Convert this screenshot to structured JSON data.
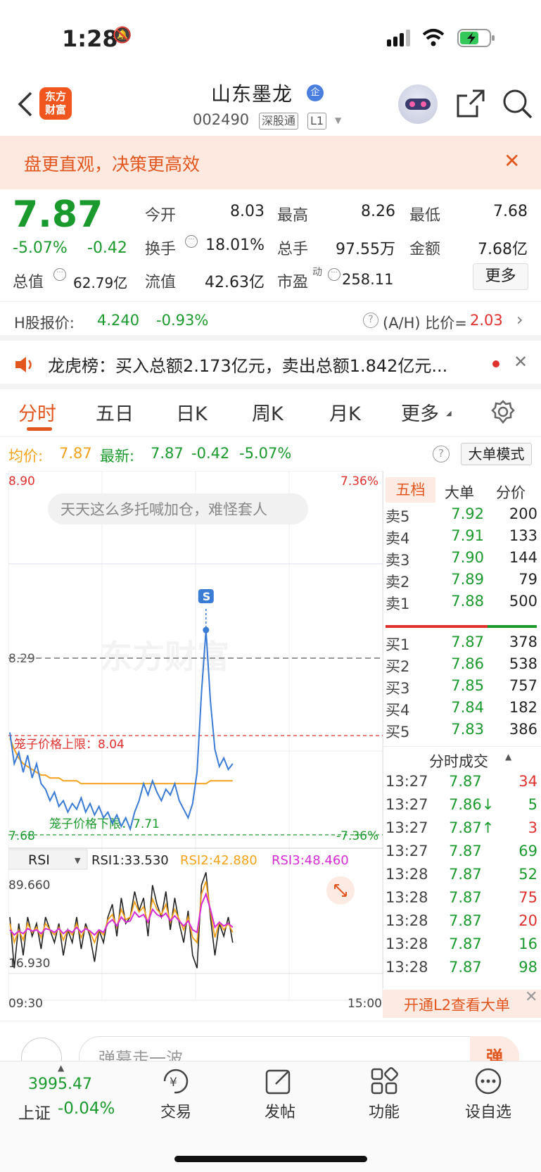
{
  "status": {
    "time": "1:28"
  },
  "header": {
    "logo_line1": "东方",
    "logo_line2": "财富",
    "stock_name": "山东墨龙",
    "qi_badge": "企",
    "stock_code": "002490",
    "tag_market": "深股通",
    "tag_level": "L1"
  },
  "banner": {
    "text": "盘更直观，决策更高效"
  },
  "quote": {
    "price": "7.87",
    "pct": "-5.07%",
    "change": "-0.42",
    "open_label": "今开",
    "open": "8.03",
    "high_label": "最高",
    "high": "8.26",
    "low_label": "最低",
    "low": "7.68",
    "turnover_label": "换手",
    "turnover": "18.01%",
    "volume_label": "总手",
    "volume": "97.55万",
    "amount_label": "金额",
    "amount": "7.68亿",
    "mktcap_label": "总值",
    "mktcap": "62.79亿",
    "float_label": "流值",
    "float": "42.63亿",
    "pe_label": "市盈",
    "pe_sup": "动",
    "pe": "258.11",
    "more": "更多"
  },
  "h_share": {
    "label": "H股报价:",
    "price": "4.240",
    "pct": "-0.93%",
    "ratio_label": "(A/H) 比价=",
    "ratio": "2.03"
  },
  "dragon_tiger": {
    "text": "龙虎榜：买入总额2.173亿元，卖出总额1.842亿元..."
  },
  "tabs": [
    "分时",
    "五日",
    "日K",
    "周K",
    "月K",
    "更多"
  ],
  "info": {
    "avg_label": "均价:",
    "avg": "7.87",
    "latest_label": "最新:",
    "latest": "7.87",
    "change": "-0.42",
    "pct": "-5.07%",
    "mode": "大单模式"
  },
  "chart": {
    "y_top": "8.90",
    "y_top_pct": "7.36%",
    "y_bottom": "7.68",
    "y_bottom_pct": "-7.36%",
    "prev_close": "8.29",
    "upper_limit_label": "笼子价格上限：8.04",
    "lower_limit_label": "笼子价格下限：7.71",
    "comment": "天天这么多托喊加仓，难怪套人",
    "watermark": "东方财富",
    "signal": "S",
    "time_start": "09:30",
    "time_end": "15:00",
    "rsi_select": "RSI",
    "rsi1": "RSI1:33.530",
    "rsi2": "RSI2:42.880",
    "rsi3": "RSI3:48.460",
    "rsi_top": "89.660",
    "rsi_bottom": "16.930",
    "colors": {
      "price": "#3a7bd5",
      "avg": "#f4a21a",
      "rsi1": "#222222",
      "rsi2": "#f4a21a",
      "rsi3": "#d42bd4"
    }
  },
  "chart_data": {
    "type": "line",
    "x_range": [
      "09:30",
      "15:00"
    ],
    "ylim": [
      7.68,
      8.9
    ],
    "reference_lines": {
      "prev_close": 8.29,
      "upper_limit": 8.04,
      "lower_limit": 7.71
    },
    "series": [
      {
        "name": "price",
        "values": [
          8.04,
          7.93,
          7.97,
          7.9,
          7.96,
          7.88,
          7.93,
          7.86,
          7.84,
          7.8,
          7.83,
          7.78,
          7.8,
          7.76,
          7.79,
          7.77,
          7.81,
          7.76,
          7.79,
          7.75,
          7.78,
          7.74,
          7.76,
          7.72,
          7.75,
          7.71,
          7.74,
          7.7,
          7.76,
          7.8,
          7.86,
          7.82,
          7.87,
          7.83,
          7.8,
          7.84,
          7.82,
          7.86,
          7.8,
          7.77,
          7.74,
          7.79,
          7.9,
          8.18,
          8.4,
          8.15,
          7.98,
          7.92,
          7.95,
          7.91,
          7.93
        ]
      },
      {
        "name": "均价",
        "values": [
          8.02,
          7.98,
          7.95,
          7.93,
          7.92,
          7.91,
          7.9,
          7.89,
          7.89,
          7.88,
          7.88,
          7.88,
          7.87,
          7.87,
          7.87,
          7.87,
          7.86,
          7.86,
          7.86,
          7.86,
          7.86,
          7.86,
          7.86,
          7.86,
          7.86,
          7.86,
          7.86,
          7.86,
          7.86,
          7.86,
          7.86,
          7.86,
          7.86,
          7.86,
          7.86,
          7.86,
          7.86,
          7.86,
          7.86,
          7.86,
          7.86,
          7.86,
          7.86,
          7.86,
          7.86,
          7.87,
          7.87,
          7.87,
          7.87,
          7.87,
          7.87
        ]
      }
    ],
    "rsi": {
      "ylim": [
        16.93,
        89.66
      ],
      "series": [
        {
          "name": "RSI1",
          "values": [
            60,
            20,
            55,
            30,
            60,
            45,
            55,
            35,
            60,
            50,
            40,
            55,
            30,
            50,
            40,
            60,
            35,
            55,
            45,
            25,
            50,
            40,
            60,
            70,
            45,
            75,
            55,
            60,
            80,
            65,
            75,
            45,
            85,
            70,
            60,
            80,
            50,
            75,
            55,
            40,
            65,
            30,
            20,
            85,
            95,
            60,
            30,
            55,
            45,
            60,
            40
          ]
        },
        {
          "name": "RSI2",
          "values": [
            55,
            40,
            50,
            42,
            55,
            48,
            52,
            44,
            55,
            50,
            46,
            52,
            42,
            50,
            46,
            55,
            44,
            52,
            48,
            40,
            50,
            46,
            58,
            62,
            52,
            66,
            58,
            60,
            72,
            64,
            68,
            55,
            74,
            66,
            62,
            70,
            56,
            66,
            58,
            50,
            60,
            44,
            40,
            78,
            88,
            64,
            44,
            56,
            50,
            55,
            48
          ]
        },
        {
          "name": "RSI3",
          "values": [
            50,
            46,
            49,
            47,
            51,
            49,
            50,
            47,
            51,
            50,
            48,
            51,
            47,
            50,
            48,
            52,
            48,
            51,
            49,
            46,
            50,
            48,
            55,
            58,
            53,
            60,
            56,
            57,
            64,
            60,
            62,
            56,
            66,
            62,
            60,
            63,
            57,
            61,
            57,
            53,
            57,
            50,
            48,
            70,
            78,
            66,
            52,
            56,
            53,
            55,
            52
          ]
        }
      ]
    }
  },
  "order_book": {
    "tabs": [
      "五档",
      "大单",
      "分价"
    ],
    "asks": [
      {
        "label": "卖5",
        "price": "7.92",
        "vol": "200"
      },
      {
        "label": "卖4",
        "price": "7.91",
        "vol": "133"
      },
      {
        "label": "卖3",
        "price": "7.90",
        "vol": "144"
      },
      {
        "label": "卖2",
        "price": "7.89",
        "vol": "79"
      },
      {
        "label": "卖1",
        "price": "7.88",
        "vol": "500"
      }
    ],
    "bids": [
      {
        "label": "买1",
        "price": "7.87",
        "vol": "378"
      },
      {
        "label": "买2",
        "price": "7.86",
        "vol": "538"
      },
      {
        "label": "买3",
        "price": "7.85",
        "vol": "757"
      },
      {
        "label": "买4",
        "price": "7.84",
        "vol": "182"
      },
      {
        "label": "买5",
        "price": "7.83",
        "vol": "386"
      }
    ],
    "trades_header": "分时成交",
    "trades": [
      {
        "time": "13:27",
        "price": "7.87",
        "vol": "34",
        "dir": "red"
      },
      {
        "time": "13:27",
        "price": "7.86↓",
        "vol": "5",
        "dir": "green"
      },
      {
        "time": "13:27",
        "price": "7.87↑",
        "vol": "3",
        "dir": "red"
      },
      {
        "time": "13:27",
        "price": "7.87",
        "vol": "69",
        "dir": "green"
      },
      {
        "time": "13:28",
        "price": "7.87",
        "vol": "52",
        "dir": "green"
      },
      {
        "time": "13:28",
        "price": "7.87",
        "vol": "75",
        "dir": "red"
      },
      {
        "time": "13:28",
        "price": "7.87",
        "vol": "20",
        "dir": "red"
      },
      {
        "time": "13:28",
        "price": "7.87",
        "vol": "16",
        "dir": "green"
      },
      {
        "time": "13:28",
        "price": "7.87",
        "vol": "98",
        "dir": "green"
      }
    ],
    "l2": "开通L2查看大单"
  },
  "danmu": {
    "placeholder": "弹幕走一波",
    "send": "弹"
  },
  "bottom_nav": {
    "index_value": "3995.47",
    "index_name": "上证",
    "index_pct": "-0.04%",
    "items": [
      "交易",
      "发帖",
      "功能",
      "设自选"
    ]
  }
}
